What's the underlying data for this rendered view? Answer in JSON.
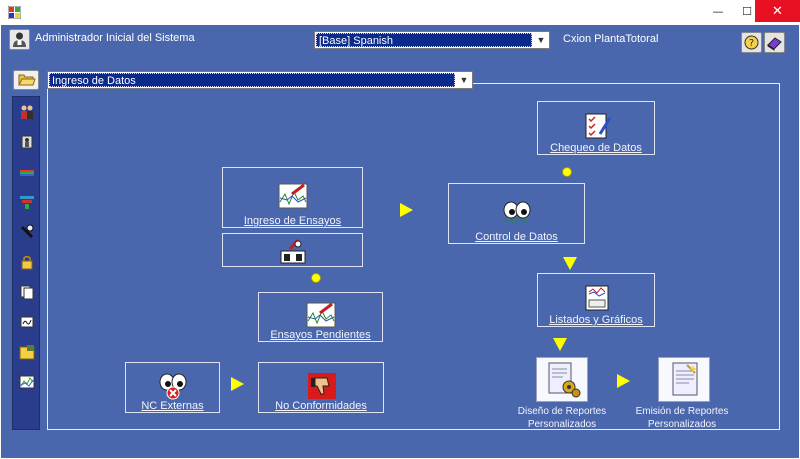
{
  "header": {
    "user_label": "Administrador Inicial del Sistema",
    "language_selected": "[Base] Spanish",
    "connection_label": "Cxion PlantaTotoral"
  },
  "window_controls": {
    "minimize": "—",
    "maximize": "☐",
    "close": "✕"
  },
  "module": {
    "selected": "Ingreso de Datos"
  },
  "nodes": {
    "chequeo": "Chequeo de Datos",
    "ingreso_ensayos": "Ingreso de Ensayos",
    "control": "Control de Datos",
    "listados": "Listados y Gráficos",
    "pendientes": "Ensayos Pendientes",
    "nc_externas": "NC Externas",
    "no_conformidades": "No Conformidades",
    "diseno_line1": "Diseño de Reportes",
    "diseno_line2": "Personalizados",
    "emision_line1": "Emisión de Reportes",
    "emision_line2": "Personalizados"
  },
  "colors": {
    "background": "#4a67ae",
    "toolbar": "#2a3d8c",
    "arrow": "#ffff00",
    "selection": "#0a2a8c",
    "close": "#e81123"
  },
  "icons": [
    "app-icon",
    "user-icon",
    "help-icon",
    "book-icon",
    "folder-icon",
    "people-icon",
    "person-icon",
    "color-bars-icon",
    "network-icon",
    "tools-icon",
    "lock-icon",
    "documents-icon",
    "signature-icon",
    "folder-yellow-icon",
    "chart-icon"
  ]
}
